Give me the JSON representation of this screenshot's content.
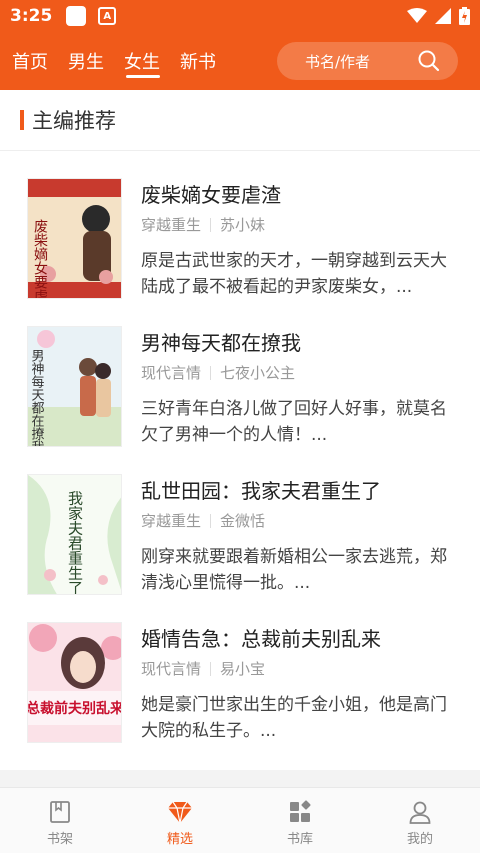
{
  "status_bar": {
    "time": "3:25",
    "app_badge": "A"
  },
  "top_nav": {
    "tabs": [
      {
        "label": "首页",
        "active": false
      },
      {
        "label": "男生",
        "active": false
      },
      {
        "label": "女生",
        "active": true
      },
      {
        "label": "新书",
        "active": false
      }
    ],
    "search_placeholder": "书名/作者",
    "accent_color": "#f05a1a"
  },
  "section": {
    "title": "主编推荐"
  },
  "books": [
    {
      "title": "废柴嫡女要虐渣",
      "genre": "穿越重生",
      "author": "苏小妹",
      "description": "原是古武世家的天才，一朝穿越到云天大陆成了最不被看起的尹家废柴女，...",
      "cover_text": "废柴嫡女要虐渣"
    },
    {
      "title": "男神每天都在撩我",
      "genre": "现代言情",
      "author": "七夜小公主",
      "description": "三好青年白洛儿做了回好人好事，就莫名欠了男神一个的人情！...",
      "cover_text": "男神每天都在撩我"
    },
    {
      "title": "乱世田园：我家夫君重生了",
      "genre": "穿越重生",
      "author": "金微恬",
      "description": "刚穿来就要跟着新婚相公一家去逃荒，郑清浅心里慌得一批。...",
      "cover_text": "我家夫君重生了"
    },
    {
      "title": "婚情告急：总裁前夫别乱来",
      "genre": "现代言情",
      "author": "易小宝",
      "description": "她是豪门世家出生的千金小姐，他是高门大院的私生子。...",
      "cover_text": "总裁前夫别乱来"
    }
  ],
  "bottom_nav": [
    {
      "label": "书架",
      "icon": "bookshelf-icon",
      "active": false
    },
    {
      "label": "精选",
      "icon": "diamond-icon",
      "active": true
    },
    {
      "label": "书库",
      "icon": "library-grid-icon",
      "active": false
    },
    {
      "label": "我的",
      "icon": "user-icon",
      "active": false
    }
  ]
}
